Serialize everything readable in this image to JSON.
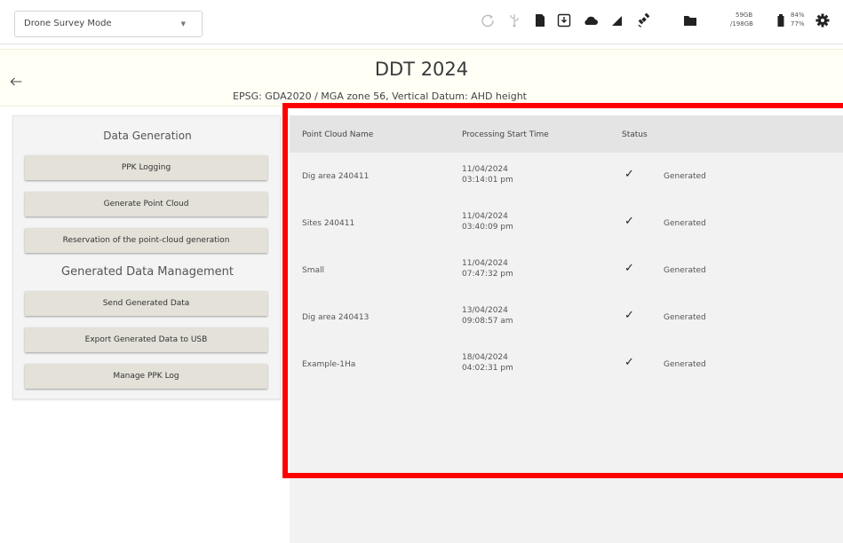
{
  "topbar": {
    "mode_select": {
      "value": "Drone Survey Mode"
    },
    "storage": {
      "used": "59GB",
      "total": "/198GB"
    },
    "battery": {
      "pct1": "84%",
      "pct2": "77%"
    }
  },
  "header": {
    "back_icon": "arrow-left-icon",
    "title": "DDT 2024",
    "subtitle": "EPSG: GDA2020 / MGA zone 56, Vertical Datum: AHD height"
  },
  "left_panel": {
    "section1_title": "Data Generation",
    "buttons1": [
      "PPK Logging",
      "Generate Point Cloud",
      "Reservation of the point-cloud generation"
    ],
    "section2_title": "Generated Data Management",
    "buttons2": [
      "Send Generated Data",
      "Export Generated Data to USB",
      "Manage PPK Log"
    ]
  },
  "table": {
    "columns": [
      "Point Cloud Name",
      "Processing Start Time",
      "Status"
    ],
    "rows": [
      {
        "name": "Dig area 240411",
        "date": "11/04/2024",
        "time": "03:14:01 pm",
        "status": "Generated"
      },
      {
        "name": "Sites 240411",
        "date": "11/04/2024",
        "time": "03:40:09 pm",
        "status": "Generated"
      },
      {
        "name": "Small",
        "date": "11/04/2024",
        "time": "07:47:32 pm",
        "status": "Generated"
      },
      {
        "name": "Dig area 240413",
        "date": "13/04/2024",
        "time": "09:08:57 am",
        "status": "Generated"
      },
      {
        "name": "Example-1Ha",
        "date": "18/04/2024",
        "time": "04:02:31 pm",
        "status": "Generated"
      }
    ],
    "check_glyph": "✓"
  },
  "colors": {
    "highlight": "#ff0000",
    "button_bg": "#e3e1d8",
    "table_bg": "#f2f2f2"
  }
}
